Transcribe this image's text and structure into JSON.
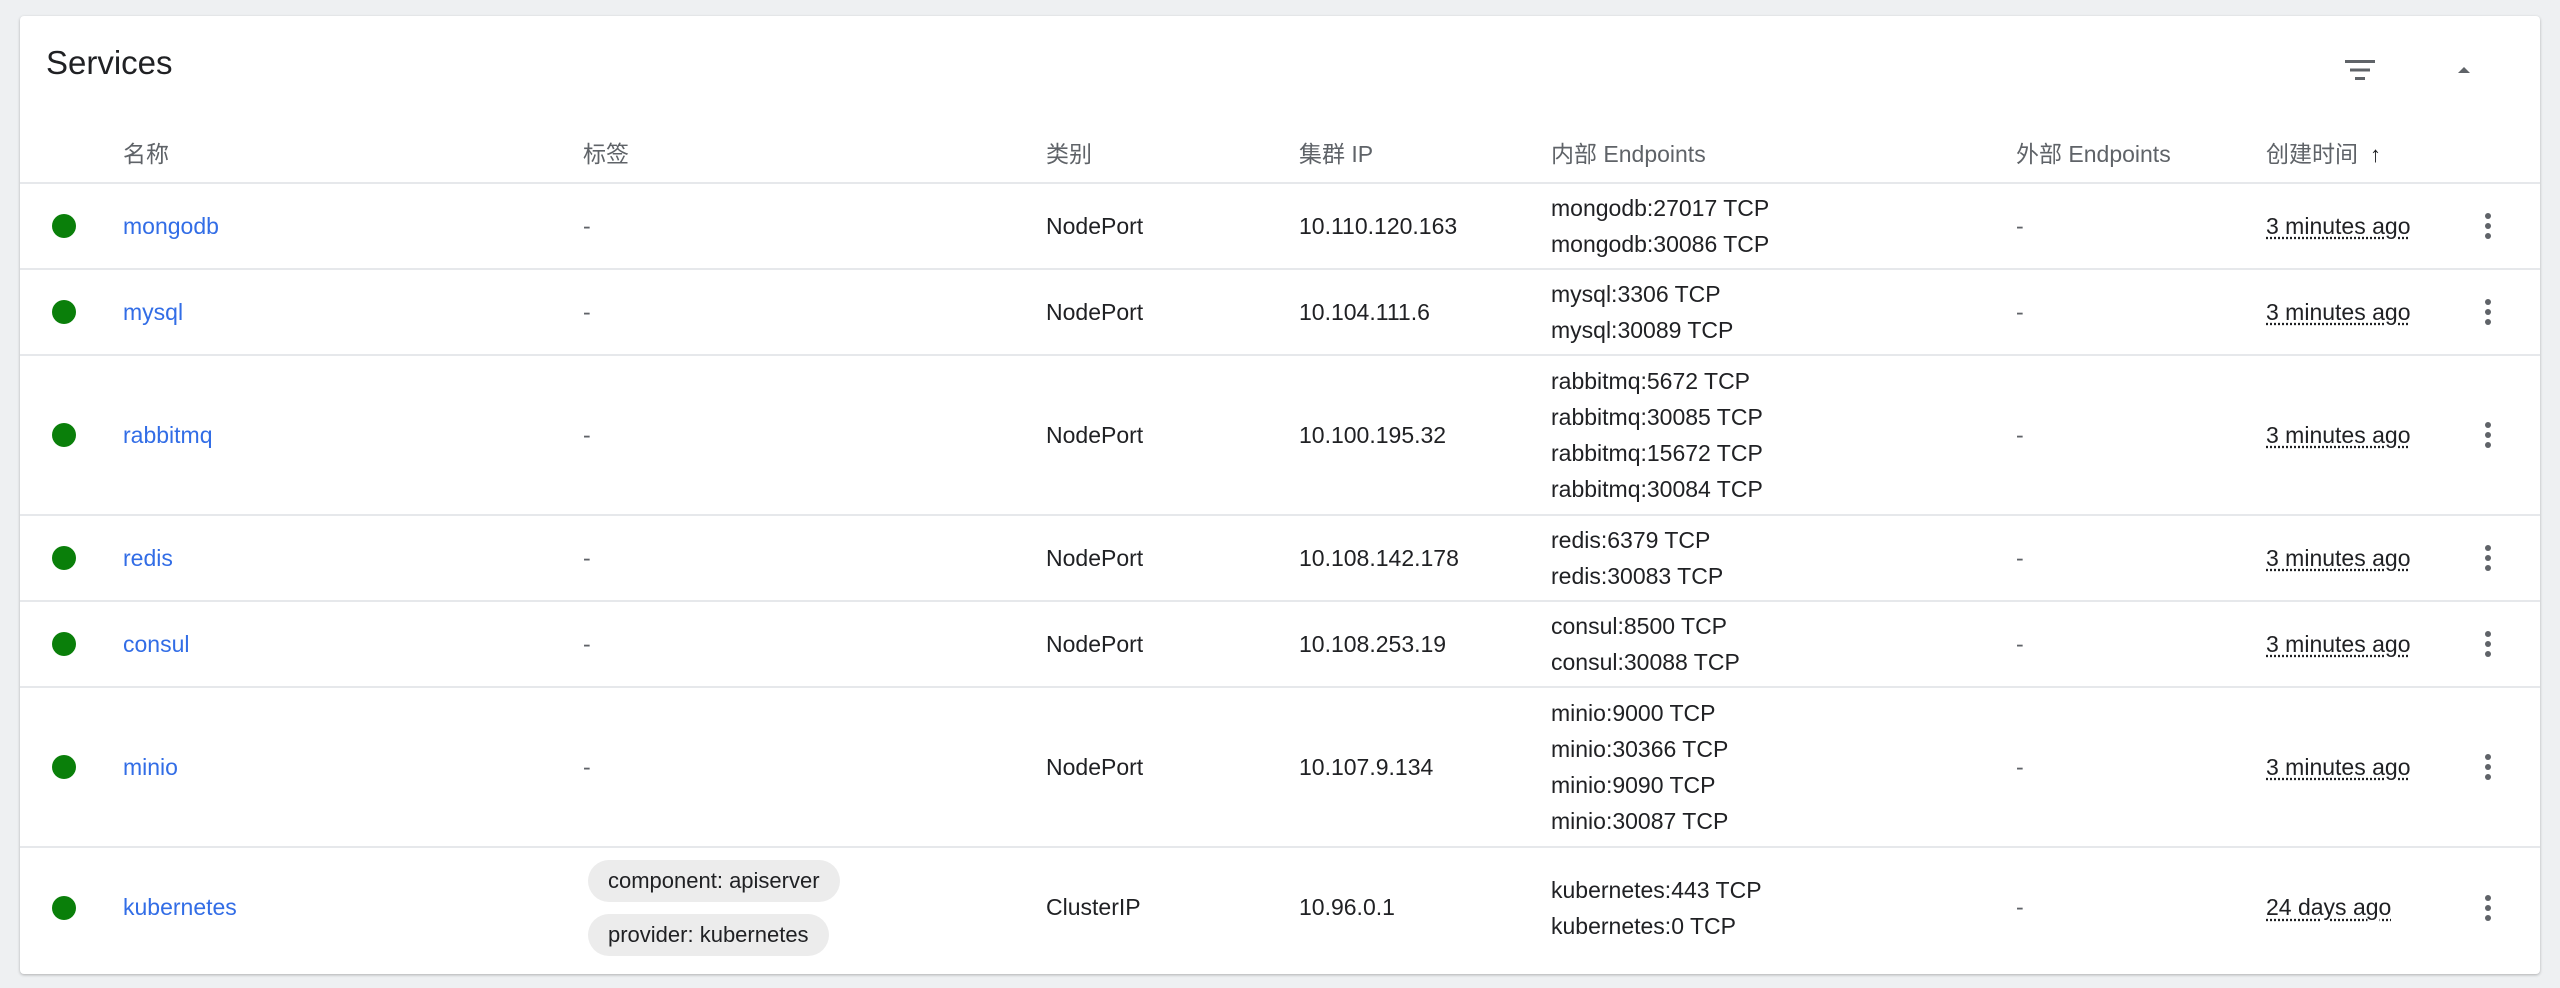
{
  "card": {
    "title": "Services"
  },
  "colors": {
    "status_ok": "#0a7f0a",
    "link": "#326de6"
  },
  "icons": {
    "filter": "filter-icon",
    "collapse": "collapse-icon",
    "more": "more-vert-icon",
    "sort": "arrow-upward-icon"
  },
  "table": {
    "headers": {
      "name": "名称",
      "labels": "标签",
      "type": "类别",
      "cluster_ip": "集群 IP",
      "internal_endpoints": "内部 Endpoints",
      "external_endpoints": "外部 Endpoints",
      "created": "创建时间",
      "sort_indicator": "↑"
    },
    "rows": [
      {
        "name": "mongodb",
        "labels_text": "-",
        "type": "NodePort",
        "cluster_ip": "10.110.120.163",
        "internal_endpoints": [
          "mongodb:27017 TCP",
          "mongodb:30086 TCP"
        ],
        "external_endpoints": "-",
        "created": "3 minutes ago"
      },
      {
        "name": "mysql",
        "labels_text": "-",
        "type": "NodePort",
        "cluster_ip": "10.104.111.6",
        "internal_endpoints": [
          "mysql:3306 TCP",
          "mysql:30089 TCP"
        ],
        "external_endpoints": "-",
        "created": "3 minutes ago"
      },
      {
        "name": "rabbitmq",
        "labels_text": "-",
        "type": "NodePort",
        "cluster_ip": "10.100.195.32",
        "internal_endpoints": [
          "rabbitmq:5672 TCP",
          "rabbitmq:30085 TCP",
          "rabbitmq:15672 TCP",
          "rabbitmq:30084 TCP"
        ],
        "external_endpoints": "-",
        "created": "3 minutes ago"
      },
      {
        "name": "redis",
        "labels_text": "-",
        "type": "NodePort",
        "cluster_ip": "10.108.142.178",
        "internal_endpoints": [
          "redis:6379 TCP",
          "redis:30083 TCP"
        ],
        "external_endpoints": "-",
        "created": "3 minutes ago"
      },
      {
        "name": "consul",
        "labels_text": "-",
        "type": "NodePort",
        "cluster_ip": "10.108.253.19",
        "internal_endpoints": [
          "consul:8500 TCP",
          "consul:30088 TCP"
        ],
        "external_endpoints": "-",
        "created": "3 minutes ago"
      },
      {
        "name": "minio",
        "labels_text": "-",
        "type": "NodePort",
        "cluster_ip": "10.107.9.134",
        "internal_endpoints": [
          "minio:9000 TCP",
          "minio:30366 TCP",
          "minio:9090 TCP",
          "minio:30087 TCP"
        ],
        "external_endpoints": "-",
        "created": "3 minutes ago"
      },
      {
        "name": "kubernetes",
        "labels": [
          "component: apiserver",
          "provider: kubernetes"
        ],
        "type": "ClusterIP",
        "cluster_ip": "10.96.0.1",
        "internal_endpoints": [
          "kubernetes:443 TCP",
          "kubernetes:0 TCP"
        ],
        "external_endpoints": "-",
        "created": "24 days ago"
      }
    ]
  }
}
